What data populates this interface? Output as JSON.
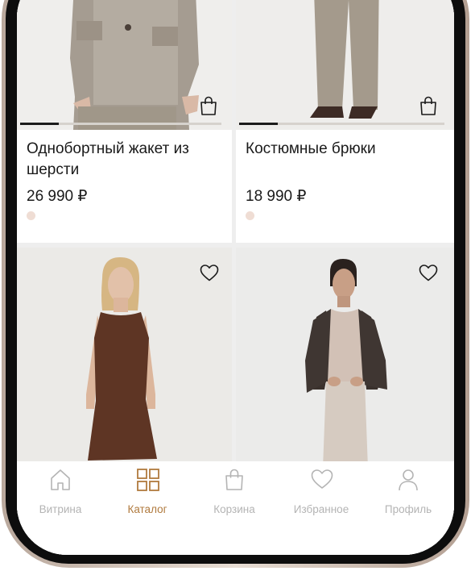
{
  "products": [
    {
      "title": "Однобортный жакет из шерсти",
      "price": "26 990 ₽",
      "swatch": "#efddd4",
      "icon": "shopping-bag-icon",
      "gallery_progress": 0.33
    },
    {
      "title": "Костюмные брюки",
      "price": "18 990 ₽",
      "swatch": "#efddd4",
      "icon": "shopping-bag-icon",
      "gallery_progress": 0.33
    },
    {
      "icon": "heart-icon"
    },
    {
      "icon": "heart-icon"
    }
  ],
  "tabbar": {
    "active": "Каталог",
    "accent_color": "#b07a3e",
    "inactive_color": "#b4b4b4",
    "items": [
      {
        "label": "Витрина",
        "icon": "home-icon"
      },
      {
        "label": "Каталог",
        "icon": "grid-icon"
      },
      {
        "label": "Корзина",
        "icon": "shopping-bag-icon"
      },
      {
        "label": "Избранное",
        "icon": "heart-icon"
      },
      {
        "label": "Профиль",
        "icon": "user-icon"
      }
    ]
  }
}
